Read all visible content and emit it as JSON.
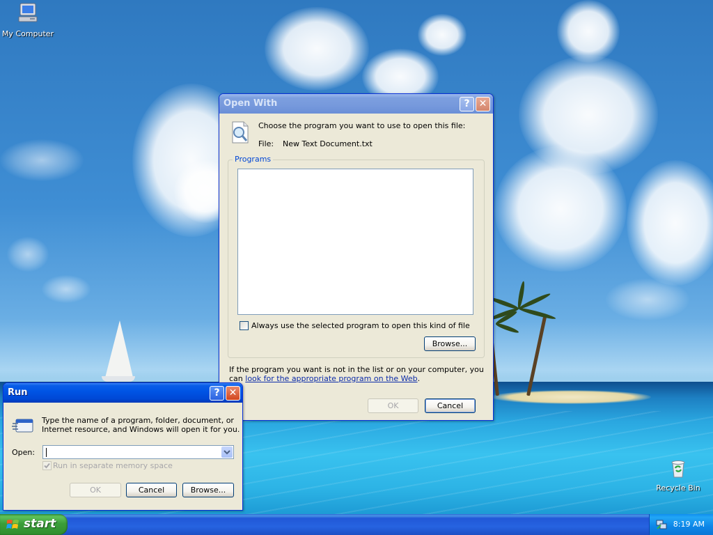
{
  "desktop": {
    "icons": [
      {
        "label": "My Computer",
        "icon": "my-computer-icon"
      },
      {
        "label": "Recycle Bin",
        "icon": "recycle-bin-icon"
      }
    ]
  },
  "open_with": {
    "title": "Open With",
    "help_button": "?",
    "close_button": "✕",
    "instruction": "Choose the program you want to use to open this file:",
    "file_label": "File:",
    "file_name": "New Text Document.txt",
    "programs_legend": "Programs",
    "programs": [],
    "always_use_label": "Always use the selected program to open this kind of file",
    "always_use_checked": false,
    "browse_label": "Browse...",
    "footer_text": "If the program you want is not in the list or on your computer, you can",
    "footer_link": "look for the appropriate program on the Web",
    "footer_end": ".",
    "ok_label": "OK",
    "cancel_label": "Cancel"
  },
  "run": {
    "title": "Run",
    "help_button": "?",
    "close_button": "✕",
    "description_line1": "Type the name of a program, folder, document, or",
    "description_line2": "Internet resource, and Windows will open it for you.",
    "open_label": "Open:",
    "open_value": "",
    "separate_memory_label": "Run in separate memory space",
    "separate_memory_checked": true,
    "ok_label": "OK",
    "cancel_label": "Cancel",
    "browse_label": "Browse..."
  },
  "taskbar": {
    "start_label": "start",
    "clock": "8:19 AM"
  },
  "colors": {
    "title_active": "#0055e5",
    "window_face": "#ece9d8",
    "taskbar": "#2663e0",
    "start_green": "#3c9e3a",
    "link": "#0b2ba8"
  }
}
